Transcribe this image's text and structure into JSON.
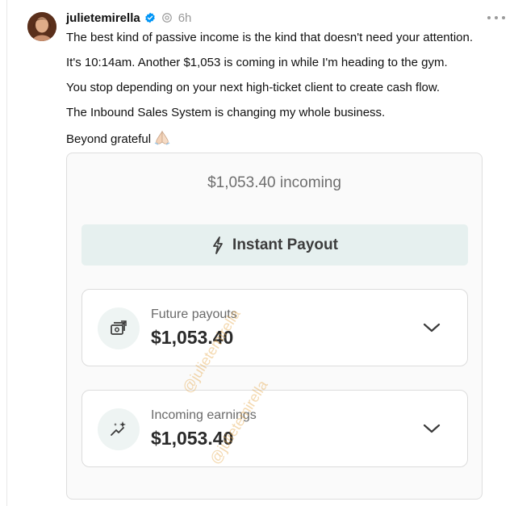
{
  "post": {
    "username": "julietemirella",
    "time": "6h",
    "lines": [
      "The best kind of passive income is the kind that doesn't need your attention.",
      "It's 10:14am. Another $1,053 is coming in while I'm heading to the gym.",
      "You stop depending on your next high-ticket client to create cash flow.",
      "The Inbound Sales System is changing my whole business.",
      "Beyond grateful"
    ],
    "emoji": "folded-hands-emoji"
  },
  "card": {
    "incoming_text": "$1,053.40 incoming",
    "payout_button_label": "Instant Payout",
    "rows": [
      {
        "label": "Future payouts",
        "amount": "$1,053.40",
        "icon": "payouts-icon"
      },
      {
        "label": "Incoming earnings",
        "amount": "$1,053.40",
        "icon": "sparkle-trend-icon"
      }
    ]
  },
  "watermark": "@julietemirella",
  "colors": {
    "verified_blue": "#0095f6",
    "button_bg": "#e6f0ef",
    "watermark": "#e6aa50"
  }
}
